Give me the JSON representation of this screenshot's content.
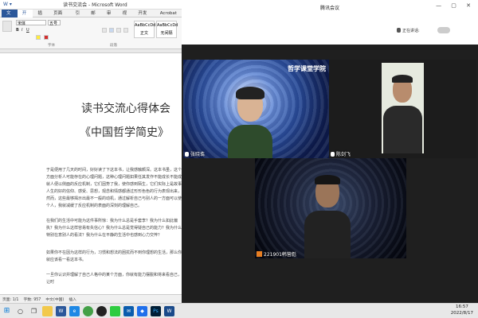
{
  "word": {
    "title": "读书交流会 - Microsoft Word",
    "tabs": [
      "文件",
      "开始",
      "插入",
      "页面布局",
      "引用",
      "邮件",
      "审阅",
      "视图",
      "开发工具",
      "Acrobat"
    ],
    "ribbon": {
      "font_name": "宋体",
      "font_size": "五号",
      "style_samples": [
        "AaBbCcDd",
        "AaBbCcDd"
      ],
      "style_labels": [
        "正文",
        "无间隔"
      ],
      "group_font": "字体",
      "group_paragraph": "段落"
    },
    "doc": {
      "title_line1": "读书交流心得体会",
      "title_line2": "《中国哲学简史》",
      "para1": "于是便用了几天的时间，好好读了下这本书，让我感触颇深。这本书虽，这个方面分析人可能存在的心理问题，这种心理问题如果任其发作不能成长不能成就人便以侧面的反应机制，它们因势了我，使你感到陌生，它们实际上是故事人生的好的信仰、感受、思想，观念和情感都通过形形色色的行为表现出来，然而，这些最够揭示出最不一般的动机，通过解析自己与别人的一方面可以使个人，我就减缓了反应机制的表面的深刻的理解自己。",
      "para2": "在我们的生活中可能为这件事所惊：我为什么总是手套李？我为什么如此偏执？我为什么这样容易有失信心？我为什么总是觉得疑自己的能力？我为什么特别在意别人的看法？我为什么在平静的生活中也感到心力交悴？",
      "para3": "如果你不在因为这样的行为，习惯和想法的困扰而不到你理想的生活，那么你就应该看一看这本书。",
      "para4": "一旦你认识并理解了自己人格中的某个方面，你就有能力摆脱和将来看自己，让时"
    },
    "status": {
      "page": "页面: 1/1",
      "words": "字数: 957",
      "lang": "中文(中国)",
      "mode": "插入"
    }
  },
  "meeting": {
    "title": "腾讯会议",
    "speaking_label": "正在讲话:",
    "participants": [
      {
        "name": "张晓翕",
        "muted": false
      },
      {
        "name": "陈剑飞",
        "muted": false
      },
      {
        "name": "221901韩营彪",
        "muted": true
      }
    ],
    "bg_banner": "哲学课堂学院"
  },
  "taskbar": {
    "time": "16:57",
    "date": "2022/8/17",
    "apps": [
      "start",
      "search",
      "taskview",
      "explorer",
      "word",
      "edge",
      "chrome",
      "qq",
      "wechat",
      "mail",
      "tencent-meeting",
      "ps",
      "word2"
    ]
  },
  "colors": {
    "word_accent": "#2b579a",
    "meeting_bg": "#1f1f1f",
    "tile_bg_blue": "#2a4d9a",
    "taskbar": "#e8e8e8"
  }
}
